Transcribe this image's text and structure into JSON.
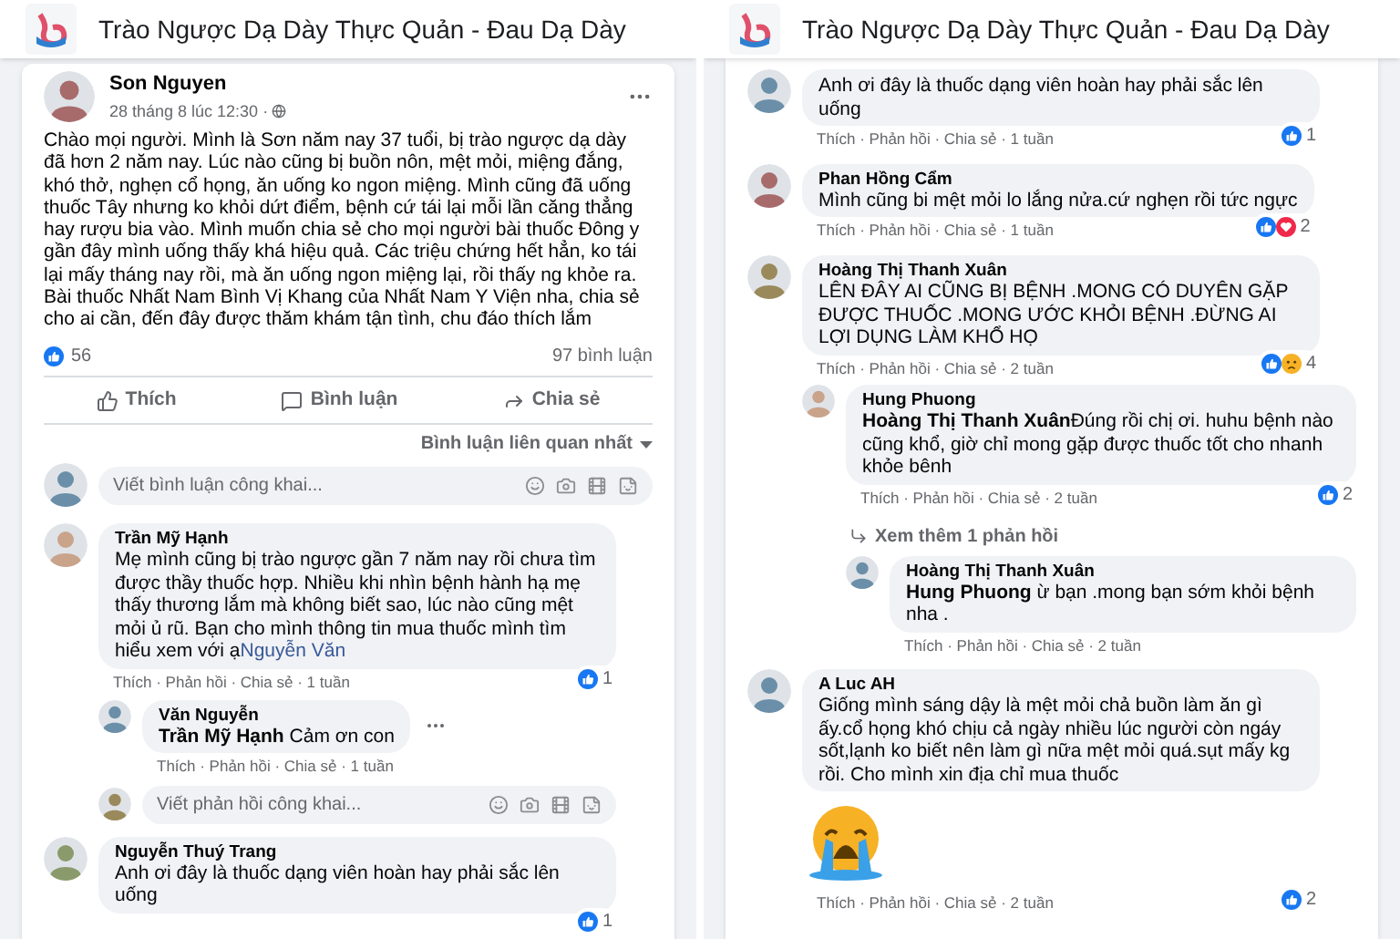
{
  "panels": [
    {
      "header": {
        "title": "Trào Ngược Dạ Dày Thực Quản - Đau Dạ Dày"
      },
      "post": {
        "author": "Son Nguyen",
        "date": "28 tháng 8 lúc 12:30 ·",
        "body": "Chào mọi người. Mình là Sơn năm nay 37 tuổi, bị trào ngược dạ dày đã hơn 2 năm nay. Lúc nào cũng bị buồn nôn, mệt mỏi, miệng đắng, khó thở, nghẹn cổ họng, ăn uống ko ngon miệng. Mình cũng đã uống thuốc Tây nhưng ko khỏi dứt điểm, bệnh cứ tái lại mỗi lần căng thẳng hay rượu bia vào. Mình muốn chia sẻ cho mọi người bài thuốc Đông y gần đây mình uống thấy khá hiệu quả. Các triệu chứng hết hẳn, ko tái lại mấy tháng nay rồi, mà ăn uống ngon miệng lại, rồi thấy ng khỏe ra. Bài thuốc Nhất Nam Bình Vị Khang của Nhất Nam Y Viện nha, chia sẻ cho ai cần, đến đây được thăm khám tận tình, chu đáo thích lắm",
        "like_count": "56",
        "comment_count": "97 bình luận",
        "actions": [
          {
            "kind": "like",
            "label": "Thích"
          },
          {
            "kind": "comment",
            "label": "Bình luận"
          },
          {
            "kind": "share",
            "label": "Chia sẻ"
          }
        ],
        "sort": "Bình luận liên quan nhất",
        "comment_input": {
          "placeholder": "Viết bình luận công khai..."
        }
      },
      "comments": [
        {
          "name": "Trần Mỹ Hạnh",
          "text": "Mẹ mình cũng bị trào ngược gần 7 năm nay rồi chưa tìm được thầy thuốc hợp. Nhiều khi nhìn bệnh hành hạ mẹ thấy thương lắm mà không biết sao, lúc nào cũng mệt mỏi ủ rũ. Bạn cho mình thông tin mua thuốc mình tìm hiểu xem với ạ",
          "link": "Nguyễn Văn",
          "meta": "Thích · Phản hồi · Chia sẻ · 1 tuần",
          "reactions": {
            "icons": [
              {
                "kind": "like"
              }
            ],
            "count": "1"
          },
          "replies": [
            {
              "name": "Văn Nguyễn",
              "text": "**Trần Mỹ Hạnh** Cảm ơn con",
              "more_menu": true,
              "meta": "Thích · Phản hồi · Chia sẻ · 1 tuần"
            }
          ],
          "reply_input": {
            "placeholder": "Viết phản hồi công khai..."
          }
        },
        {
          "name": "Nguyễn Thuý Trang",
          "text": "Anh ơi đây là thuốc dạng viên hoàn hay phải sắc lên uống",
          "reactions": {
            "icons": [
              {
                "kind": "like"
              }
            ],
            "count": "1"
          }
        }
      ]
    },
    {
      "header": {
        "title": "Trào Ngược Dạ Dày Thực Quản - Đau Dạ Dày"
      },
      "comments": [
        {
          "text": "Anh ơi đây là thuốc dạng viên hoàn hay phải sắc lên uống",
          "meta": "Thích · Phản hồi · Chia sẻ · 1 tuần",
          "reactions": {
            "icons": [
              {
                "kind": "like"
              }
            ],
            "count": "1"
          }
        },
        {
          "name": "Phan Hồng Cẩm",
          "text": "Mình cũng bi mệt mỏi lo lắng nửa.cứ nghẹn rồi tức ngực",
          "meta": "Thích · Phản hồi · Chia sẻ · 1 tuần",
          "reactions": {
            "icons": [
              {
                "kind": "like"
              },
              {
                "kind": "love"
              }
            ],
            "count": "2"
          }
        },
        {
          "name": "Hoàng Thị Thanh Xuân",
          "text": "LÊN ĐÂY AI CŨNG BỊ BỆNH .MONG CÓ DUYÊN GẶP ĐƯỢC THUỐC .MONG ƯỚC KHỎI BỆNH .ĐỪNG AI LỢI DỤNG LÀM KHỔ HỌ",
          "meta": "Thích · Phản hồi · Chia sẻ · 2 tuần",
          "reactions": {
            "icons": [
              {
                "kind": "like"
              },
              {
                "kind": "sad"
              }
            ],
            "count": "4"
          },
          "replies": [
            {
              "name": "Hung Phuong",
              "text": "**Hoàng Thị Thanh Xuân**Đúng rồi chị ơi. huhu bệnh nào cũng khổ, giờ chỉ mong gặp được thuốc tốt cho nhanh khỏe bênh",
              "meta": "Thích · Phản hồi · Chia sẻ · 2 tuần",
              "reactions": {
                "icons": [
                  {
                    "kind": "like"
                  }
                ],
                "count": "2"
              },
              "more_replies": "Xem thêm 1 phản hồi",
              "replies": [
                {
                  "name": "Hoàng Thị Thanh Xuân",
                  "text": "**Hung Phuong** ừ bạn .mong bạn sớm khỏi bệnh nha .",
                  "meta": "Thích · Phản hồi · Chia sẻ · 2 tuần"
                }
              ]
            }
          ]
        },
        {
          "name": "A Luc AH",
          "text": "Giống mình sáng dậy là mệt mỏi chả buồn làm ăn gì ấy.cổ họng khó chịu cả ngày nhiều lúc người còn ngáy sốt,lạnh ko biết nên làm gì nữa mệt mỏi quá.sụt mấy kg rồi. Cho mình xin địa chỉ mua thuốc",
          "sticker": {
            "kind": "crying-face"
          },
          "meta": "Thích · Phản hồi · Chia sẻ · 2 tuần",
          "reactions": {
            "icons": [
              {
                "kind": "like"
              }
            ],
            "count": "2"
          }
        }
      ]
    }
  ]
}
